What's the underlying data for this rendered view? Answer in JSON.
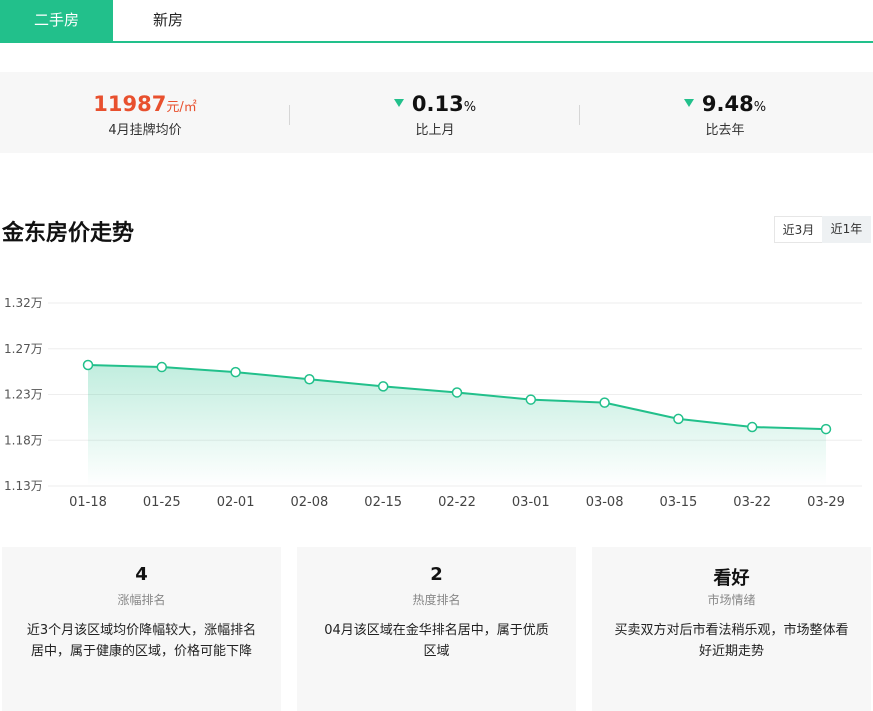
{
  "tabs": [
    {
      "label": "二手房",
      "active": true
    },
    {
      "label": "新房",
      "active": false
    }
  ],
  "stats": {
    "price": {
      "value": "11987",
      "unit": "元/㎡",
      "label": "4月挂牌均价"
    },
    "month": {
      "value": "0.13",
      "unit": "%",
      "label": "比上月",
      "direction": "down"
    },
    "year": {
      "value": "9.48",
      "unit": "%",
      "label": "比去年",
      "direction": "down"
    }
  },
  "trend": {
    "title": "金东房价走势",
    "ranges": [
      "近3月",
      "近1年"
    ],
    "selected_range": "近1年"
  },
  "chart_data": {
    "type": "area",
    "x": [
      "01-18",
      "01-25",
      "02-01",
      "02-08",
      "02-15",
      "02-22",
      "03-01",
      "03-08",
      "03-15",
      "03-22",
      "03-29"
    ],
    "y_ticks": [
      "1.32万",
      "1.27万",
      "1.23万",
      "1.18万",
      "1.13万"
    ],
    "y_tick_values": [
      13200,
      12750,
      12300,
      11850,
      11400
    ],
    "ylim": [
      11400,
      13200
    ],
    "series": [
      {
        "values": [
          12590,
          12570,
          12520,
          12450,
          12380,
          12320,
          12250,
          12220,
          12060,
          11980,
          11960
        ]
      }
    ],
    "grid": true,
    "color": "#22c08b"
  },
  "cards": [
    {
      "value": "4",
      "label": "涨幅排名",
      "desc": "近3个月该区域均价降幅较大，涨幅排名居中，属于健康的区域，价格可能下降"
    },
    {
      "value": "2",
      "label": "热度排名",
      "desc": "04月该区域在金华排名居中，属于优质区域"
    },
    {
      "value": "看好",
      "label": "市场情绪",
      "desc": "买卖双方对后市看法稍乐观，市场整体看好近期走势"
    }
  ],
  "colors": {
    "accent": "#22c08b",
    "price": "#e8502e"
  }
}
